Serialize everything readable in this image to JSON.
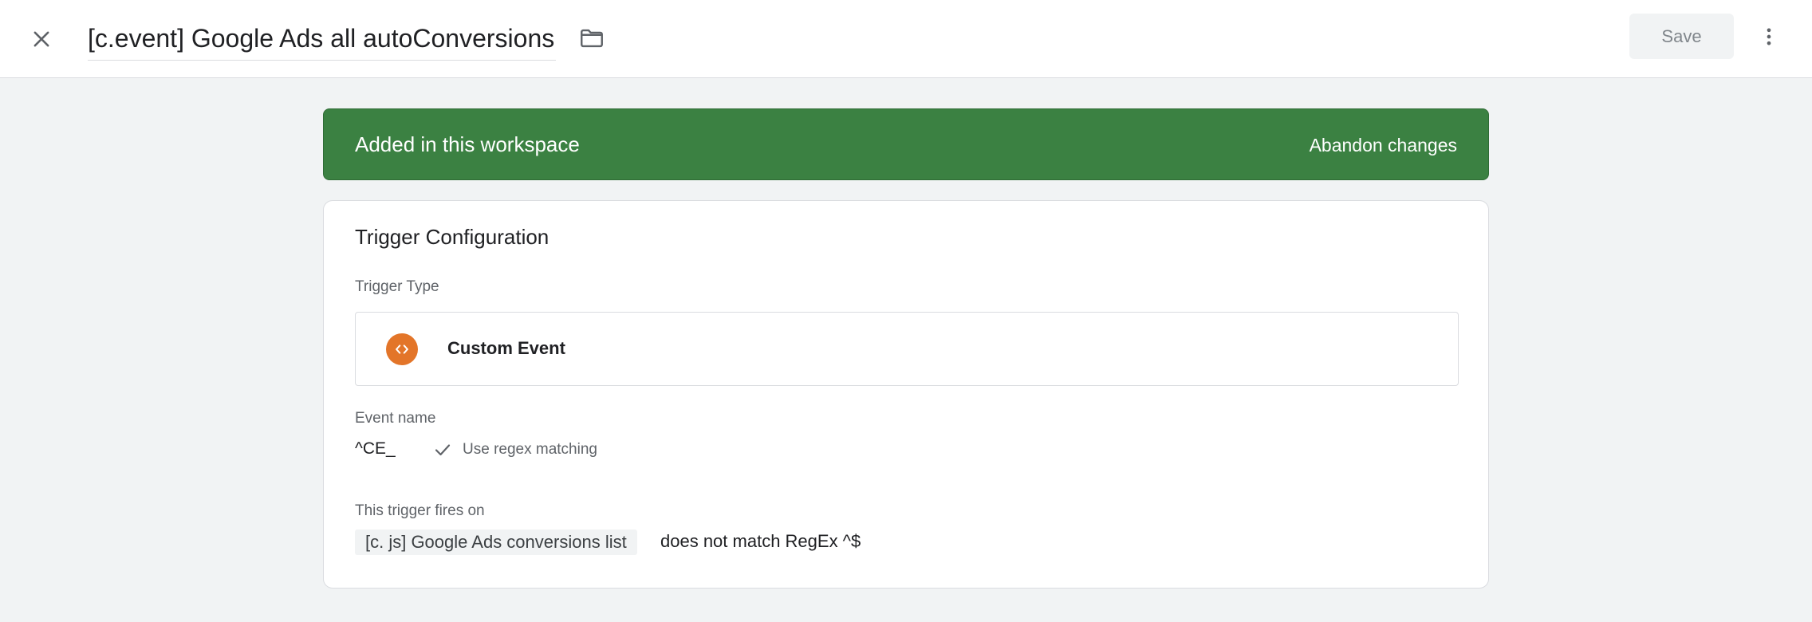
{
  "header": {
    "close_icon": "close-icon",
    "title": "[c.event] Google Ads all autoConversions",
    "folder_icon": "folder-icon",
    "save_label": "Save",
    "more_icon": "more-vert-icon"
  },
  "banner": {
    "text": "Added in this workspace",
    "action_label": "Abandon changes",
    "color": "#3b8142"
  },
  "trigger_config": {
    "title": "Trigger Configuration",
    "type_label": "Trigger Type",
    "type": {
      "icon": "code-brackets-icon",
      "icon_color": "#e37529",
      "name": "Custom Event"
    },
    "event_name_label": "Event name",
    "event_name_value": "^CE_",
    "regex_check_icon": "check-icon",
    "regex_label": "Use regex matching",
    "fires_on_label": "This trigger fires on",
    "condition": {
      "variable": "[c. js] Google Ads conversions list",
      "operator_and_value": "does not match RegEx ^$"
    }
  }
}
